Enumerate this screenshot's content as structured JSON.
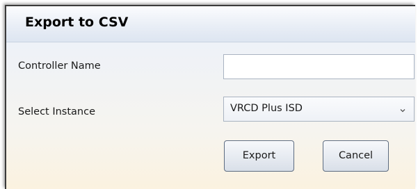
{
  "dialog": {
    "title": "Export to CSV"
  },
  "form": {
    "controller_name_label": "Controller Name",
    "controller_name_value": "",
    "controller_name_placeholder": "",
    "select_instance_label": "Select Instance",
    "select_instance_value": "VRCD Plus ISD",
    "select_icon": "chevron-down-icon"
  },
  "buttons": {
    "export_label": "Export",
    "cancel_label": "Cancel"
  }
}
